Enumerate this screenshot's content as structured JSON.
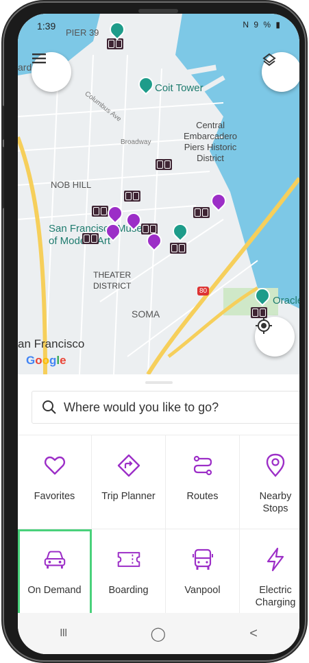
{
  "status": {
    "time": "1:39",
    "icons": "N 9 % ▮"
  },
  "map": {
    "labels": {
      "pier39": "PIER 39",
      "coit": "Coit Tower",
      "embarcadero": "Central\nEmbarcadero\nPiers Historic\nDistrict",
      "nobhill": "NOB HILL",
      "sfmoma": "San Francisco Museum\nof Modern Art",
      "theater": "THEATER\nDISTRICT",
      "soma": "SOMA",
      "oracle": "Oracle P",
      "sf": "an Francisco",
      "ard": "ard",
      "columbus": "Columbus Ave",
      "broadway": "Broadway",
      "hwy80": "80"
    },
    "google": [
      "G",
      "o",
      "o",
      "g",
      "l",
      "e"
    ]
  },
  "search": {
    "placeholder": "Where would you like to go?"
  },
  "tiles": [
    {
      "label": "Favorites",
      "icon": "heart-icon"
    },
    {
      "label": "Trip Planner",
      "icon": "directions-icon"
    },
    {
      "label": "Routes",
      "icon": "route-icon"
    },
    {
      "label": "Nearby\nStops",
      "icon": "location-pin-icon"
    },
    {
      "label": "On Demand",
      "icon": "car-icon"
    },
    {
      "label": "Boarding",
      "icon": "ticket-icon"
    },
    {
      "label": "Vanpool",
      "icon": "bus-icon"
    },
    {
      "label": "Electric\nCharging",
      "icon": "lightning-icon"
    }
  ],
  "navbar": {
    "recent": "III",
    "home": "◯",
    "back": "<"
  },
  "colors": {
    "accent": "#9c2ec7",
    "selected_outline": "#49d17b",
    "water": "#7dc8e6",
    "road": "#f6cf5b"
  }
}
